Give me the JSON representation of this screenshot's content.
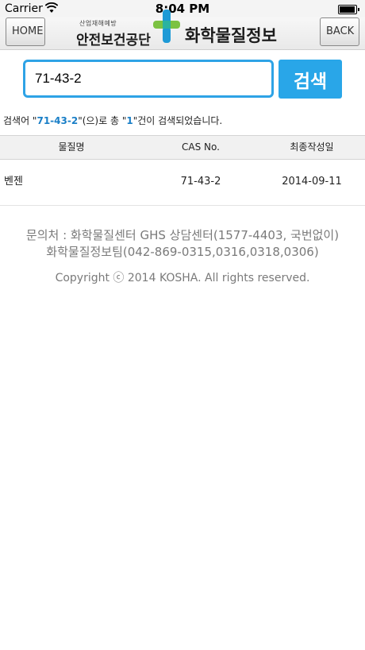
{
  "status_bar": {
    "carrier": "Carrier",
    "time": "8:04 PM",
    "battery_level": 1.0
  },
  "header": {
    "home_label": "HOME",
    "back_label": "BACK",
    "logo_tagline": "산업재해예방",
    "logo_org": "안전보건공단",
    "title": "화학물질정보",
    "logo_colors": {
      "green": "#7cc242",
      "blue": "#1e9ad6"
    }
  },
  "search": {
    "value": "71-43-2",
    "button_label": "검색",
    "accent_color": "#29a6e8"
  },
  "summary": {
    "prefix": "검색어 \"",
    "query": "71-43-2",
    "middle": "\"(으)로 총 \"",
    "count": "1",
    "suffix": "\"건이 검색되었습니다."
  },
  "table": {
    "headers": [
      "물질명",
      "CAS No.",
      "최종작성일"
    ],
    "rows": [
      {
        "name": "벤젠",
        "cas": "71-43-2",
        "date": "2014-09-11"
      }
    ]
  },
  "footer": {
    "contact_line1": "문의처 : 화학물질센터 GHS 상담센터(1577-4403, 국번없이)",
    "contact_line2": "화학물질정보팀(042-869-0315,0316,0318,0306)",
    "copyright": "Copyright ⓒ 2014 KOSHA. All rights reserved."
  }
}
